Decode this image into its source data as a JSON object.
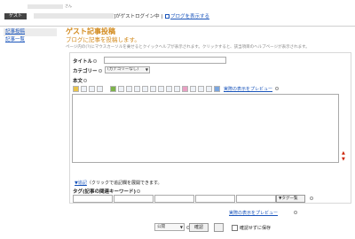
{
  "topbar": {
    "user_badge": "ゲスト",
    "user_suffix": "さん",
    "login_status": "]がゲストログイン中 |",
    "blog_link": "ブログを表示する"
  },
  "sidebar": {
    "items": [
      {
        "label": "記事投稿",
        "active": true
      },
      {
        "label": "記事一覧",
        "active": false
      }
    ]
  },
  "main": {
    "title": "ゲスト記事投稿",
    "subtitle": "ブログに記事を投稿します。",
    "help": "ページ内の(?)にマウスカーソルを乗せるとクイックヘルプが表示されます。クリックすると、該当項目のヘルプページが表示されます。"
  },
  "form": {
    "title_label": "タイトル",
    "category_label": "カテゴリー",
    "category_value": "(カテゴリーなし)",
    "body_label": "本文",
    "preview_link": "実際の表示をプレビュー",
    "detail_link": "▼追記",
    "detail_text": "（クリックで追記欄を展開できます。",
    "tag_label": "タグ(記事の関連キーワード)",
    "tag_button": "▼タグ一覧",
    "preview_link_bottom": "実際の表示をプレビュー",
    "publish_value": "公開",
    "confirm_button": "確認",
    "draft_label": "確認せずに保存"
  }
}
